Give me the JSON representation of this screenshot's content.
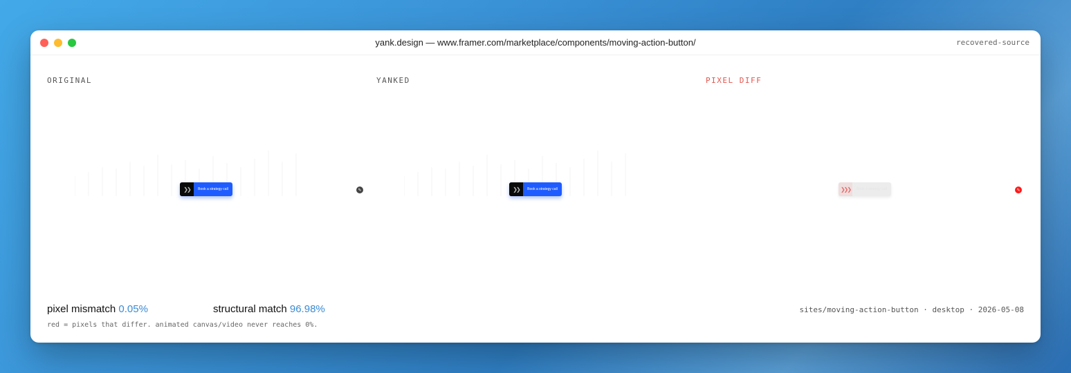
{
  "window": {
    "title": "yank.design — www.framer.com/marketplace/components/moving-action-button/",
    "corner_label": "recovered-source"
  },
  "panels": {
    "original_label": "ORIGINAL",
    "yanked_label": "YANKED",
    "diff_label": "PIXEL DIFF"
  },
  "cta": {
    "label": "Book a strategy call",
    "icon": "double-chevron-right-icon",
    "color": "#1f5cff"
  },
  "stats": {
    "pixel_mismatch_label": "pixel mismatch",
    "pixel_mismatch_value": "0.05%",
    "structural_match_label": "structural match",
    "structural_match_value": "96.98%"
  },
  "meta": "sites/moving-action-button · desktop · 2026-05-08",
  "caption": "red = pixels that differ. animated canvas/video never reaches 0%.",
  "colors": {
    "accent": "#3a8bd4",
    "diff": "#e5534b"
  }
}
